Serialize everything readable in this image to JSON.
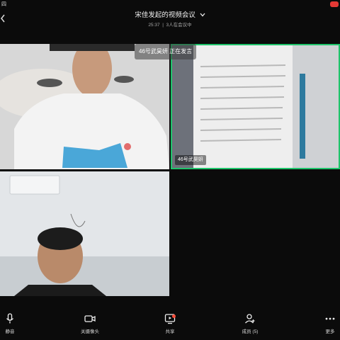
{
  "status": {
    "left_text": "四"
  },
  "meeting": {
    "title": "宋佳发起的视频会议",
    "duration": "25:37",
    "separator": "|",
    "participants_text": "3人在会议中"
  },
  "speaker": {
    "name": "46号武昊妍",
    "state": "正在发言"
  },
  "tiles": [
    {
      "name_tag": ""
    },
    {
      "name_tag": "46号武昊妍"
    },
    {
      "name_tag": ""
    },
    {
      "name_tag": ""
    }
  ],
  "toolbar": {
    "mute_label": "静音",
    "camera_label": "关摄像头",
    "share_label": "共享",
    "members_label": "成员 (5)",
    "more_label": "更多"
  }
}
